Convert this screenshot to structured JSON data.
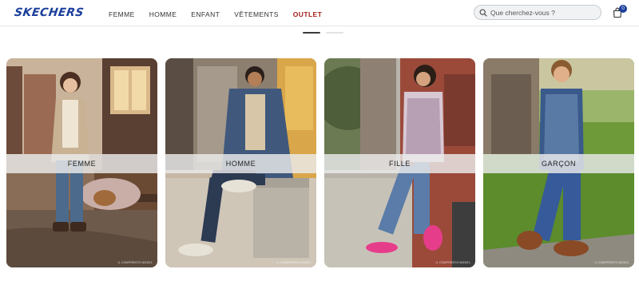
{
  "header": {
    "logo": "SKECHERS",
    "nav": [
      {
        "label": "FEMME"
      },
      {
        "label": "HOMME"
      },
      {
        "label": "ENFANT"
      },
      {
        "label": "VÊTEMENTS"
      },
      {
        "label": "OUTLET"
      }
    ],
    "search": {
      "placeholder": "Que cherchez-vous ?"
    },
    "cart": {
      "count": "0"
    }
  },
  "carousel": {
    "active_index": 0,
    "total": 2
  },
  "cards": [
    {
      "label": "FEMME",
      "credit": "IL COMPRENTO MODEL"
    },
    {
      "label": "HOMME",
      "credit": "IL COMPRENTO MODEL"
    },
    {
      "label": "FILLE",
      "credit": "IL COMPRENTO MODEL"
    },
    {
      "label": "GARÇON",
      "credit": "IL COMPRENTO MODEL"
    }
  ],
  "colors": {
    "brand": "#1b3f9b",
    "outlet": "#a3201b"
  }
}
